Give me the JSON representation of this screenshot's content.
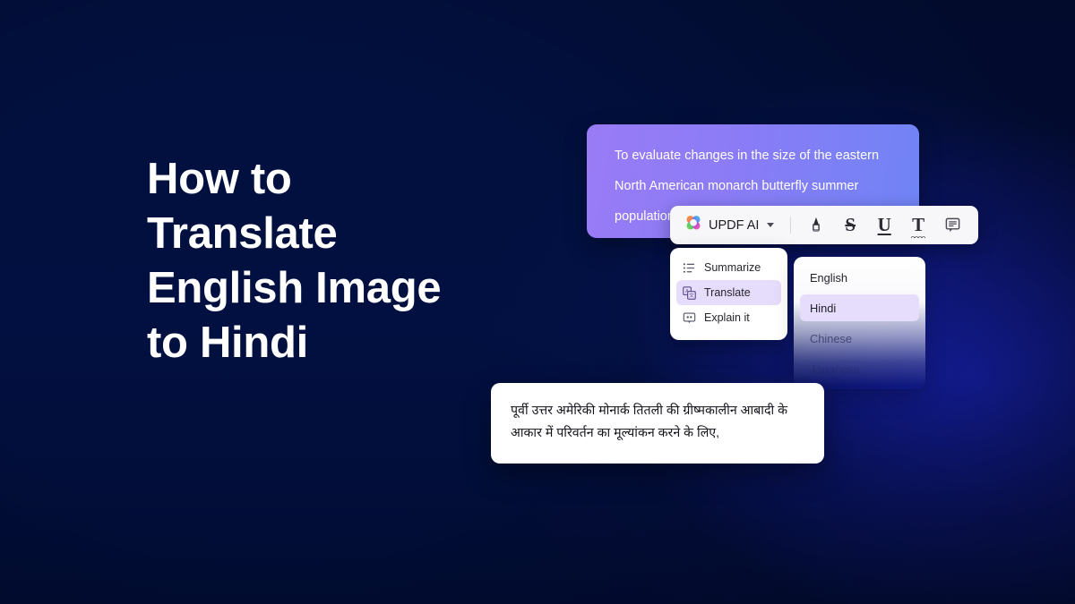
{
  "background": {
    "base_color": "#02103f",
    "glow_color": "#1e28dc"
  },
  "headline": {
    "text": "How to\nTranslate\nEnglish Image\nto Hindi",
    "color": "#ffffff"
  },
  "source_card": {
    "text": "To evaluate changes in the size of the eastern North American monarch butterfly summer population",
    "gradient_from": "#9a7bf6",
    "gradient_to": "#6f84f5"
  },
  "toolbar": {
    "ai_label": "UPDF AI",
    "logo_icon": "updf-clover-logo-icon",
    "caret_icon": "chevron-down-icon",
    "tools": [
      {
        "name": "highlighter-icon",
        "glyph": ""
      },
      {
        "name": "strikethrough-icon",
        "glyph": "S"
      },
      {
        "name": "underline-icon",
        "glyph": "U"
      },
      {
        "name": "squiggly-underline-icon",
        "glyph": "T"
      },
      {
        "name": "comment-note-icon",
        "glyph": ""
      }
    ]
  },
  "ai_menu": {
    "items": [
      {
        "label": "Summarize",
        "icon": "bullet-list-icon",
        "active": false
      },
      {
        "label": "Translate",
        "icon": "translate-icon",
        "active": true
      },
      {
        "label": "Explain it",
        "icon": "explain-bubble-icon",
        "active": false
      }
    ]
  },
  "language_panel": {
    "options": [
      {
        "label": "English",
        "state": "normal"
      },
      {
        "label": "Hindi",
        "state": "selected"
      },
      {
        "label": "Chinese",
        "state": "faded"
      },
      {
        "label": "Japanese",
        "state": "faded-more"
      }
    ],
    "selected": "Hindi",
    "highlight_color": "#e6dcfb"
  },
  "result_card": {
    "text": "पूर्वी उत्तर अमेरिकी मोनार्क तितली की ग्रीष्मकालीन आबादी के आकार में परिवर्तन का मूल्यांकन करने के लिए,"
  }
}
